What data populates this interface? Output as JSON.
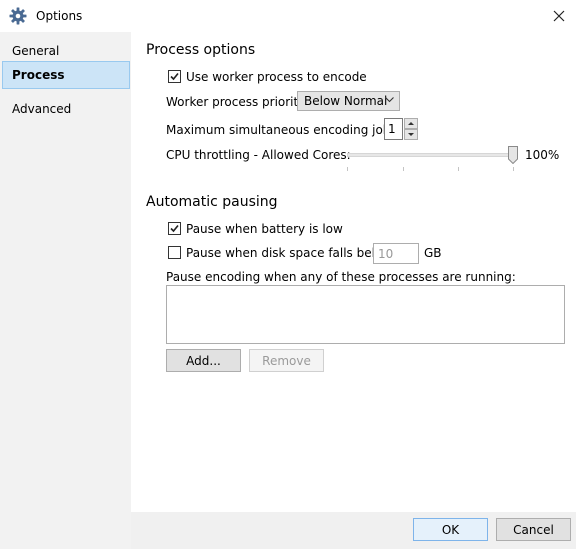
{
  "window": {
    "title": "Options",
    "icon": "gear-icon",
    "close_icon": "close-icon"
  },
  "sidebar": {
    "items": [
      {
        "label": "General",
        "selected": false
      },
      {
        "label": "Process",
        "selected": true
      },
      {
        "label": "Advanced",
        "selected": false
      }
    ]
  },
  "process_options": {
    "heading": "Process options",
    "use_worker": {
      "label": "Use worker process to encode",
      "checked": true
    },
    "priority": {
      "label": "Worker process priority:",
      "value": "Below Normal"
    },
    "max_jobs": {
      "label": "Maximum simultaneous encoding jobs:",
      "value": "1"
    },
    "cpu": {
      "label": "CPU throttling - Allowed Cores:",
      "value_label": "100%",
      "level": 1.0
    }
  },
  "automatic_pausing": {
    "heading": "Automatic pausing",
    "battery": {
      "label": "Pause when battery is low",
      "checked": true
    },
    "disk": {
      "label": "Pause when disk space falls below:",
      "checked": false,
      "value": "10",
      "unit": "GB"
    },
    "processes_label": "Pause encoding when any of these processes are running:",
    "add_label": "Add...",
    "remove_label": "Remove"
  },
  "footer": {
    "ok_label": "OK",
    "cancel_label": "Cancel"
  },
  "colors": {
    "sidebar_bg": "#f2f2f2",
    "selected_bg": "#cce4f7",
    "selected_border": "#99c9ef"
  }
}
